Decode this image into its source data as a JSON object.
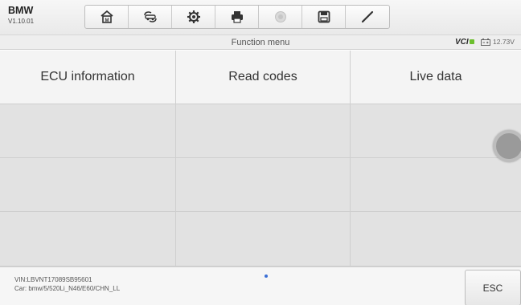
{
  "app": {
    "brand": "BMW",
    "version": "V1.10.01"
  },
  "toolbar": {
    "buttons": [
      {
        "icon": "home-icon"
      },
      {
        "icon": "vehicle-swap-icon"
      },
      {
        "icon": "gear-icon"
      },
      {
        "icon": "print-icon"
      },
      {
        "icon": "help-icon",
        "disabled": true
      },
      {
        "icon": "save-icon"
      },
      {
        "icon": "pen-icon"
      }
    ]
  },
  "titlebar": {
    "title": "Function menu",
    "vci_label": "VCI",
    "battery_voltage": "12.73V"
  },
  "functions": [
    {
      "label": "ECU information"
    },
    {
      "label": "Read codes"
    },
    {
      "label": "Live data"
    }
  ],
  "footer": {
    "vin": "VIN:LBVNT17089SB95601",
    "car": "Car: bmw/5/520Li_N46/E60/CHN_LL",
    "esc_label": "ESC"
  },
  "colors": {
    "accent_green": "#6cbf2e",
    "page_dot": "#3b6fd6"
  }
}
